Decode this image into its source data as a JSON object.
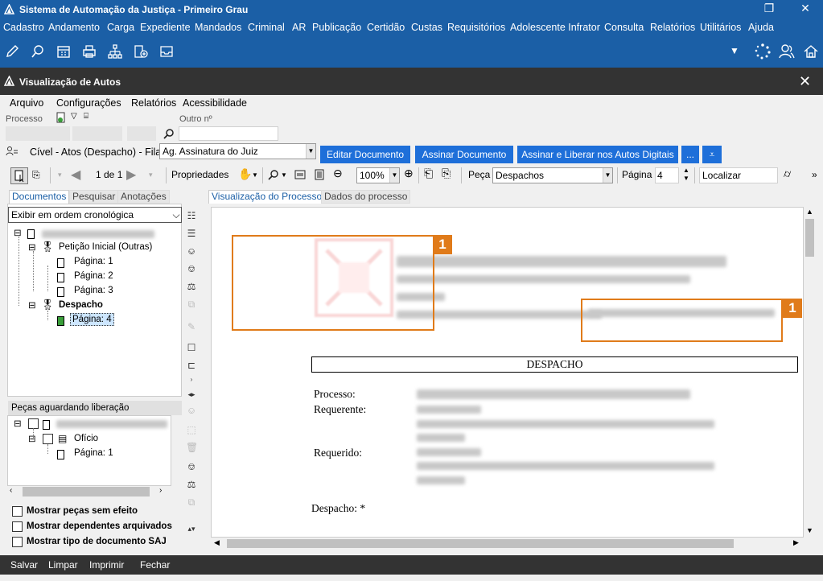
{
  "app": {
    "title": "Sistema de Automação da Justiça - Primeiro Grau",
    "menu": [
      "Cadastro",
      "Andamento",
      "Carga",
      "Expediente",
      "Mandados",
      "Criminal",
      "AR",
      "Publicação",
      "Certidão",
      "Custas",
      "Requisitórios",
      "Adolescente Infrator",
      "Consulta",
      "Relatórios",
      "Utilitários",
      "Ajuda"
    ]
  },
  "window": {
    "title": "Visualização de Autos",
    "menu": [
      "Arquivo",
      "Configurações",
      "Relatórios",
      "Acessibilidade"
    ]
  },
  "search": {
    "processo_label": "Processo",
    "outro_label": "Outro nº"
  },
  "queue": {
    "label": "Cível - Atos (Despacho) - Fila:",
    "value": "Ag. Assinatura do Juiz",
    "buttons": [
      "Editar Documento",
      "Assinar Documento",
      "Assinar e Liberar nos Autos Digitais",
      "..."
    ]
  },
  "toolbar": {
    "page_count": "1 de 1",
    "properties": "Propriedades",
    "zoom": "100%",
    "peca_label": "Peça",
    "peca_value": "Despachos",
    "pagina_label": "Página",
    "pagina_value": "4",
    "localizar": "Localizar"
  },
  "left": {
    "tabs": [
      "Documentos",
      "Pesquisar",
      "Anotações"
    ],
    "order": "Exibir em ordem cronológica",
    "tree": {
      "peticao": "Petição Inicial (Outras)",
      "pages1": [
        "Página: 1",
        "Página: 2",
        "Página: 3"
      ],
      "despacho": "Despacho",
      "page4": "Página: 4"
    },
    "pending_title": "Peças aguardando liberação",
    "pending": {
      "oficio": "Ofício",
      "page": "Página: 1"
    },
    "checks": [
      "Mostrar peças sem efeito",
      "Mostrar dependentes arquivados",
      "Mostrar tipo de documento SAJ"
    ]
  },
  "viewer": {
    "tabs": [
      "Visualização do Processo",
      "Dados do processo"
    ],
    "badge": "1",
    "doc_title": "DESPACHO",
    "labels": [
      "Processo:",
      "Requerente:",
      "Requerido:",
      "Despacho: *"
    ]
  },
  "bottom": [
    "Salvar",
    "Limpar",
    "Imprimir",
    "Fechar"
  ],
  "colors": {
    "brand": "#1b5fa6",
    "accent": "#1e6fd9",
    "highlight": "#e07b1a",
    "dark": "#333333"
  }
}
